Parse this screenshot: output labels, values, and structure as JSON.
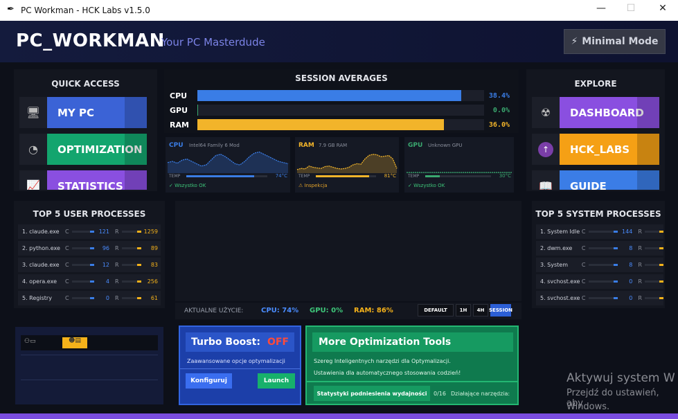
{
  "window": {
    "title": "PC Workman - HCK Labs v1.5.0",
    "minimize": "—",
    "maximize": "☐",
    "close": "✕"
  },
  "header": {
    "brand": "PC_WORKMAN",
    "tagline": "Your PC Masterdude",
    "minimal_mode": "Minimal Mode"
  },
  "quick_access": {
    "title": "QUICK ACCESS",
    "items": [
      {
        "label": "MY PC",
        "icon": "monitor-icon",
        "color": "#3b63d6"
      },
      {
        "label": "OPTIMIZATION",
        "icon": "gauge-icon",
        "color": "#13a56e"
      },
      {
        "label": "STATISTICS",
        "icon": "chart-icon",
        "color": "#8a4fe0"
      }
    ]
  },
  "session": {
    "title": "SESSION AVERAGES",
    "bars": [
      {
        "name": "CPU",
        "pct": "38.4%",
        "value": 0.92,
        "color": "#3a7de6"
      },
      {
        "name": "GPU",
        "pct": "0.0%",
        "value": 0.003,
        "color": "#3aa86f"
      },
      {
        "name": "RAM",
        "pct": "36.0%",
        "value": 0.86,
        "color": "#f2b42a"
      }
    ]
  },
  "cards": [
    {
      "title": "CPU",
      "sub": "Intel64 Family 6 Mod",
      "temp_label": "TEMP",
      "temp": "74°C",
      "temp_fill": 0.84,
      "status": "✓ Wszystko OK",
      "color": "#3a7de6",
      "status_color": "#3ec77a"
    },
    {
      "title": "RAM",
      "sub": "7.9 GB RAM",
      "temp_label": "TEMP",
      "temp": "81°C",
      "temp_fill": 0.88,
      "status": "⚠ Inspekcja",
      "color": "#f2b42a",
      "status_color": "#e2a22a"
    },
    {
      "title": "GPU",
      "sub": "Unknown GPU",
      "temp_label": "TEMP",
      "temp": "30°C",
      "temp_fill": 0.22,
      "status": "✓ Wszystko OK",
      "color": "#3aa86f",
      "status_color": "#3ec77a"
    }
  ],
  "explore": {
    "title": "EXPLORE",
    "items": [
      {
        "label": "DASHBOARD",
        "icon": "radiation-icon",
        "color": "#8a4fe0"
      },
      {
        "label": "HCK_LABS",
        "icon": "arrow-up-icon",
        "color": "#f5a015"
      },
      {
        "label": "GUIDE",
        "icon": "book-icon",
        "color": "#3b7de6"
      }
    ]
  },
  "user_processes": {
    "title": "TOP 5 USER PROCESSES",
    "c_label": "C",
    "r_label": "R",
    "rows": [
      {
        "name": "1. claude.exe",
        "cpu": "121",
        "ram": "1259"
      },
      {
        "name": "2. python.exe",
        "cpu": "96",
        "ram": "89"
      },
      {
        "name": "3. claude.exe",
        "cpu": "12",
        "ram": "83"
      },
      {
        "name": "4. opera.exe",
        "cpu": "4",
        "ram": "256"
      },
      {
        "name": "5. Registry",
        "cpu": "0",
        "ram": "61"
      }
    ]
  },
  "system_processes": {
    "title": "TOP 5 SYSTEM PROCESSES",
    "c_label": "C",
    "r_label": "R",
    "rows": [
      {
        "name": "1. System Idle Pr",
        "cpu": "144",
        "ram": ""
      },
      {
        "name": "2. dwm.exe",
        "cpu": "8",
        "ram": ""
      },
      {
        "name": "3. System",
        "cpu": "8",
        "ram": ""
      },
      {
        "name": "4. svchost.exe",
        "cpu": "0",
        "ram": ""
      },
      {
        "name": "5. svchost.exe",
        "cpu": "0",
        "ram": ""
      }
    ]
  },
  "usage": {
    "label": "AKTUALNE UŻYCIE:",
    "cpu": "CPU: 74%",
    "gpu": "GPU: 0%",
    "ram": "RAM: 86%",
    "tabs": [
      "DEFAULT",
      "1H",
      "4H",
      "SESSION"
    ]
  },
  "turbo": {
    "title": "Turbo Boost:",
    "state": "OFF",
    "desc": "Zaawansowane opcje optymalizacji",
    "configure": "Konfiguruj",
    "launch": "Launch"
  },
  "tools": {
    "title": "More Optimization Tools",
    "line1": "Szereg Inteligentnych narzędzi dla Optymalizacji.",
    "line2": "Ustawienia dla automatycznego stosowania codzień!",
    "stats_button": "Statystyki podniesienia wydajności",
    "count": "0/16",
    "active_label": "Działające narzędzia:"
  },
  "watermark": {
    "line1": "Aktywuj system W",
    "line2": "Przejdź do ustawień, aby",
    "line3": "Windows."
  }
}
